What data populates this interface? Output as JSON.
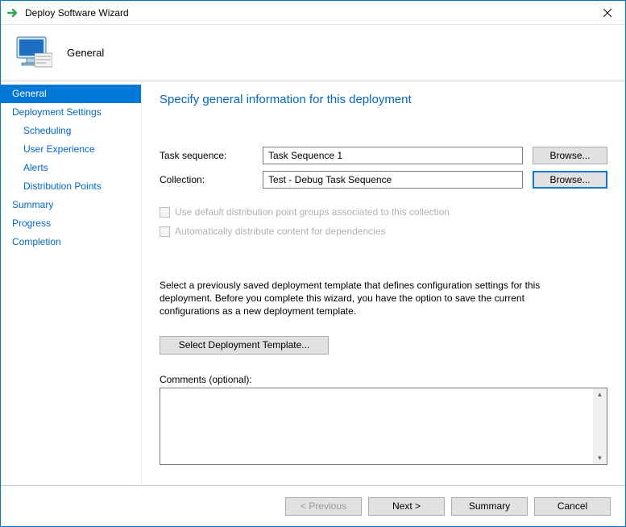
{
  "window": {
    "title": "Deploy Software Wizard"
  },
  "header": {
    "title": "General"
  },
  "sidebar": {
    "items": [
      {
        "label": "General",
        "selected": true,
        "child": false
      },
      {
        "label": "Deployment Settings",
        "selected": false,
        "child": false
      },
      {
        "label": "Scheduling",
        "selected": false,
        "child": true
      },
      {
        "label": "User Experience",
        "selected": false,
        "child": true
      },
      {
        "label": "Alerts",
        "selected": false,
        "child": true
      },
      {
        "label": "Distribution Points",
        "selected": false,
        "child": true
      },
      {
        "label": "Summary",
        "selected": false,
        "child": false
      },
      {
        "label": "Progress",
        "selected": false,
        "child": false
      },
      {
        "label": "Completion",
        "selected": false,
        "child": false
      }
    ]
  },
  "content": {
    "heading": "Specify general information for this deployment",
    "task_sequence_label": "Task sequence:",
    "task_sequence_value": "Task Sequence 1",
    "collection_label": "Collection:",
    "collection_value": "Test - Debug Task Sequence",
    "browse_label": "Browse...",
    "checkbox1": "Use default distribution point groups associated to this collection",
    "checkbox2": "Automatically distribute content for dependencies",
    "help_text": "Select a previously saved deployment template that defines configuration settings for this deployment. Before you complete this wizard, you have the option to save the current configurations as a new deployment template.",
    "template_button": "Select Deployment Template...",
    "comments_label": "Comments (optional):",
    "comments_value": ""
  },
  "footer": {
    "previous": "< Previous",
    "next": "Next >",
    "summary": "Summary",
    "cancel": "Cancel"
  }
}
